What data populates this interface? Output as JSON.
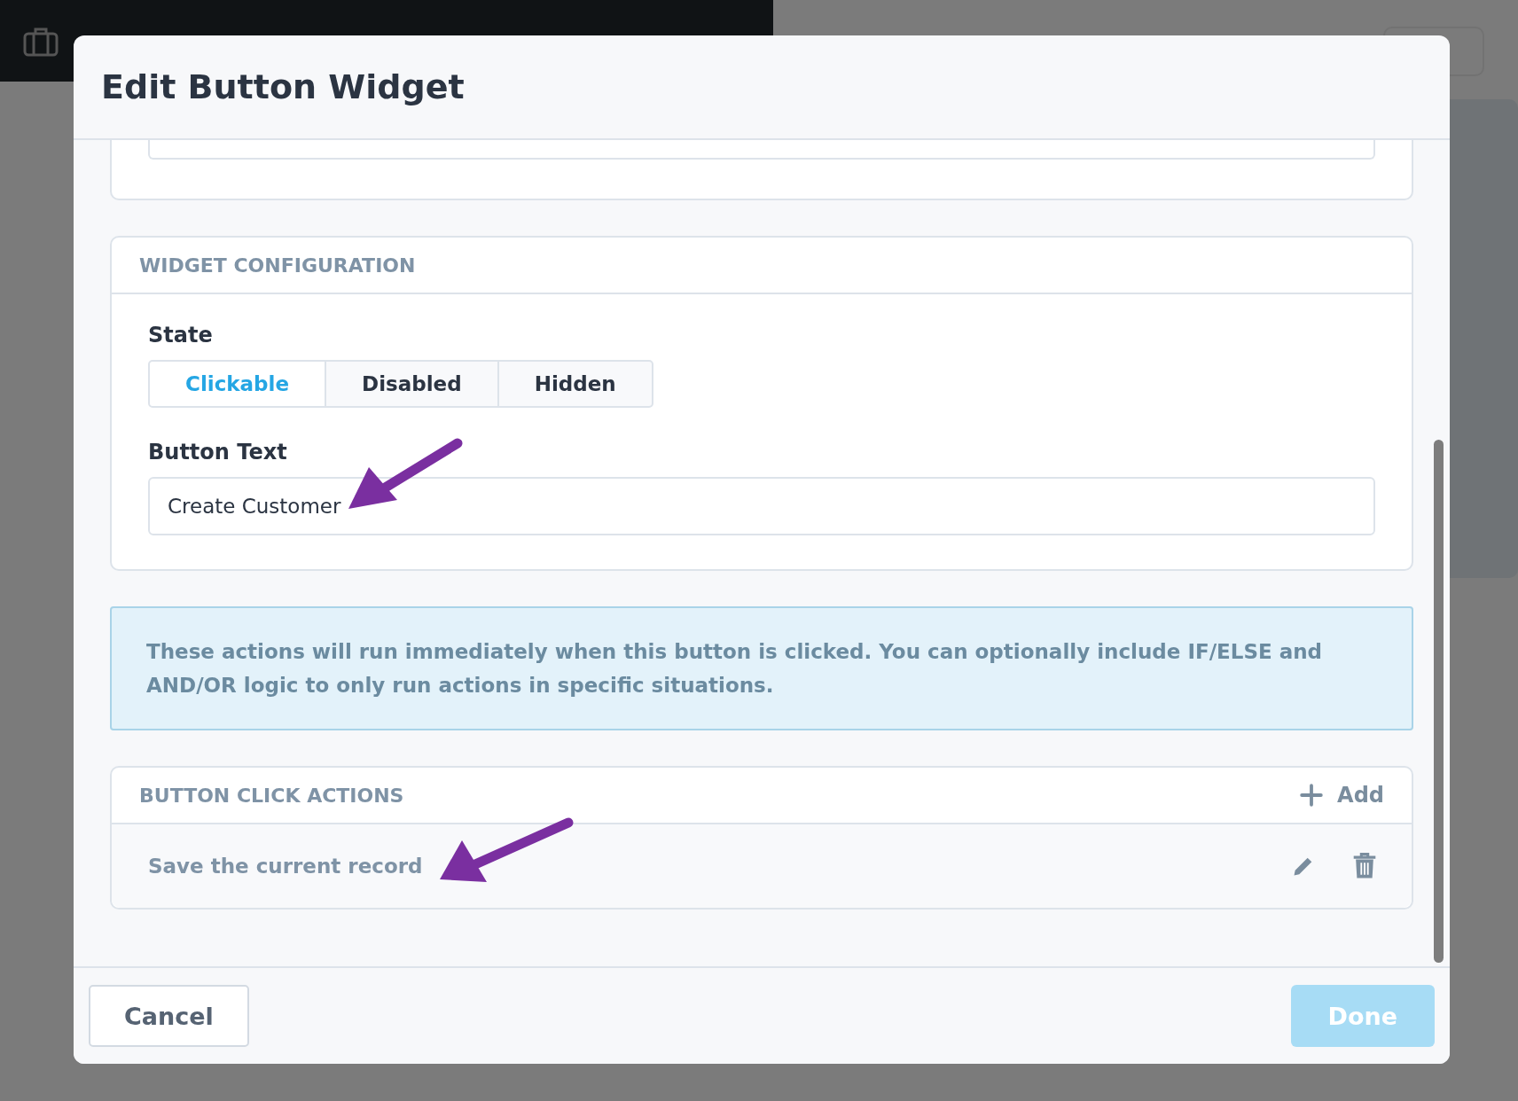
{
  "dialog": {
    "title": "Edit Button Widget"
  },
  "widget_configuration": {
    "heading": "WIDGET CONFIGURATION",
    "state_label": "State",
    "state_options": [
      {
        "label": "Clickable",
        "selected": true
      },
      {
        "label": "Disabled",
        "selected": false
      },
      {
        "label": "Hidden",
        "selected": false
      }
    ],
    "button_text_label": "Button Text",
    "button_text_value": "Create Customer"
  },
  "info": "These actions will run immediately when this button is clicked. You can optionally include IF/ELSE and AND/OR logic to only run actions in specific situations.",
  "button_click_actions": {
    "heading": "BUTTON CLICK ACTIONS",
    "add_label": "Add",
    "items": [
      {
        "label": "Save the current record"
      }
    ]
  },
  "footer": {
    "cancel": {
      "label": "Cancel",
      "disabled": false
    },
    "done": {
      "label": "Done",
      "disabled": true
    }
  }
}
